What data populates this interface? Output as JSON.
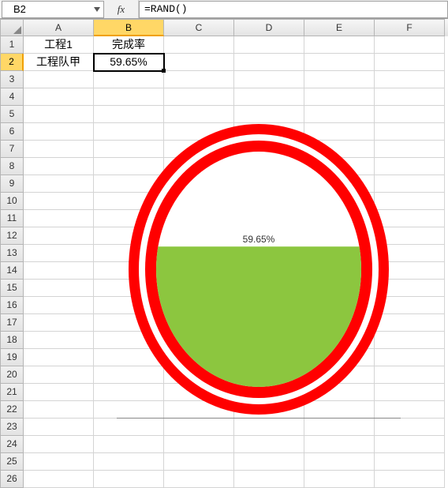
{
  "name_box": {
    "value": "B2"
  },
  "formula_bar": {
    "fx_label": "fx",
    "formula": "=RAND()"
  },
  "columns": [
    "A",
    "B",
    "C",
    "D",
    "E",
    "F"
  ],
  "selected_col_index": 1,
  "row_count": 26,
  "selected_row_index": 2,
  "cells": {
    "A1": "工程1",
    "B1": "完成率",
    "A2": "工程队甲",
    "B2": "59.65%"
  },
  "selected_cell": "B2",
  "chart_data": {
    "type": "pie",
    "title": "",
    "style": "liquid-fill-gauge",
    "percent_label": "59.65%",
    "fill_ratio": 0.5965,
    "colors": {
      "ring": "#ff0000",
      "fill": "#8cc63f",
      "empty": "#ffffff"
    },
    "notes": "Circular gauge/progress (double red ring, green fill from bottom). Label shows percent at liquid surface."
  }
}
